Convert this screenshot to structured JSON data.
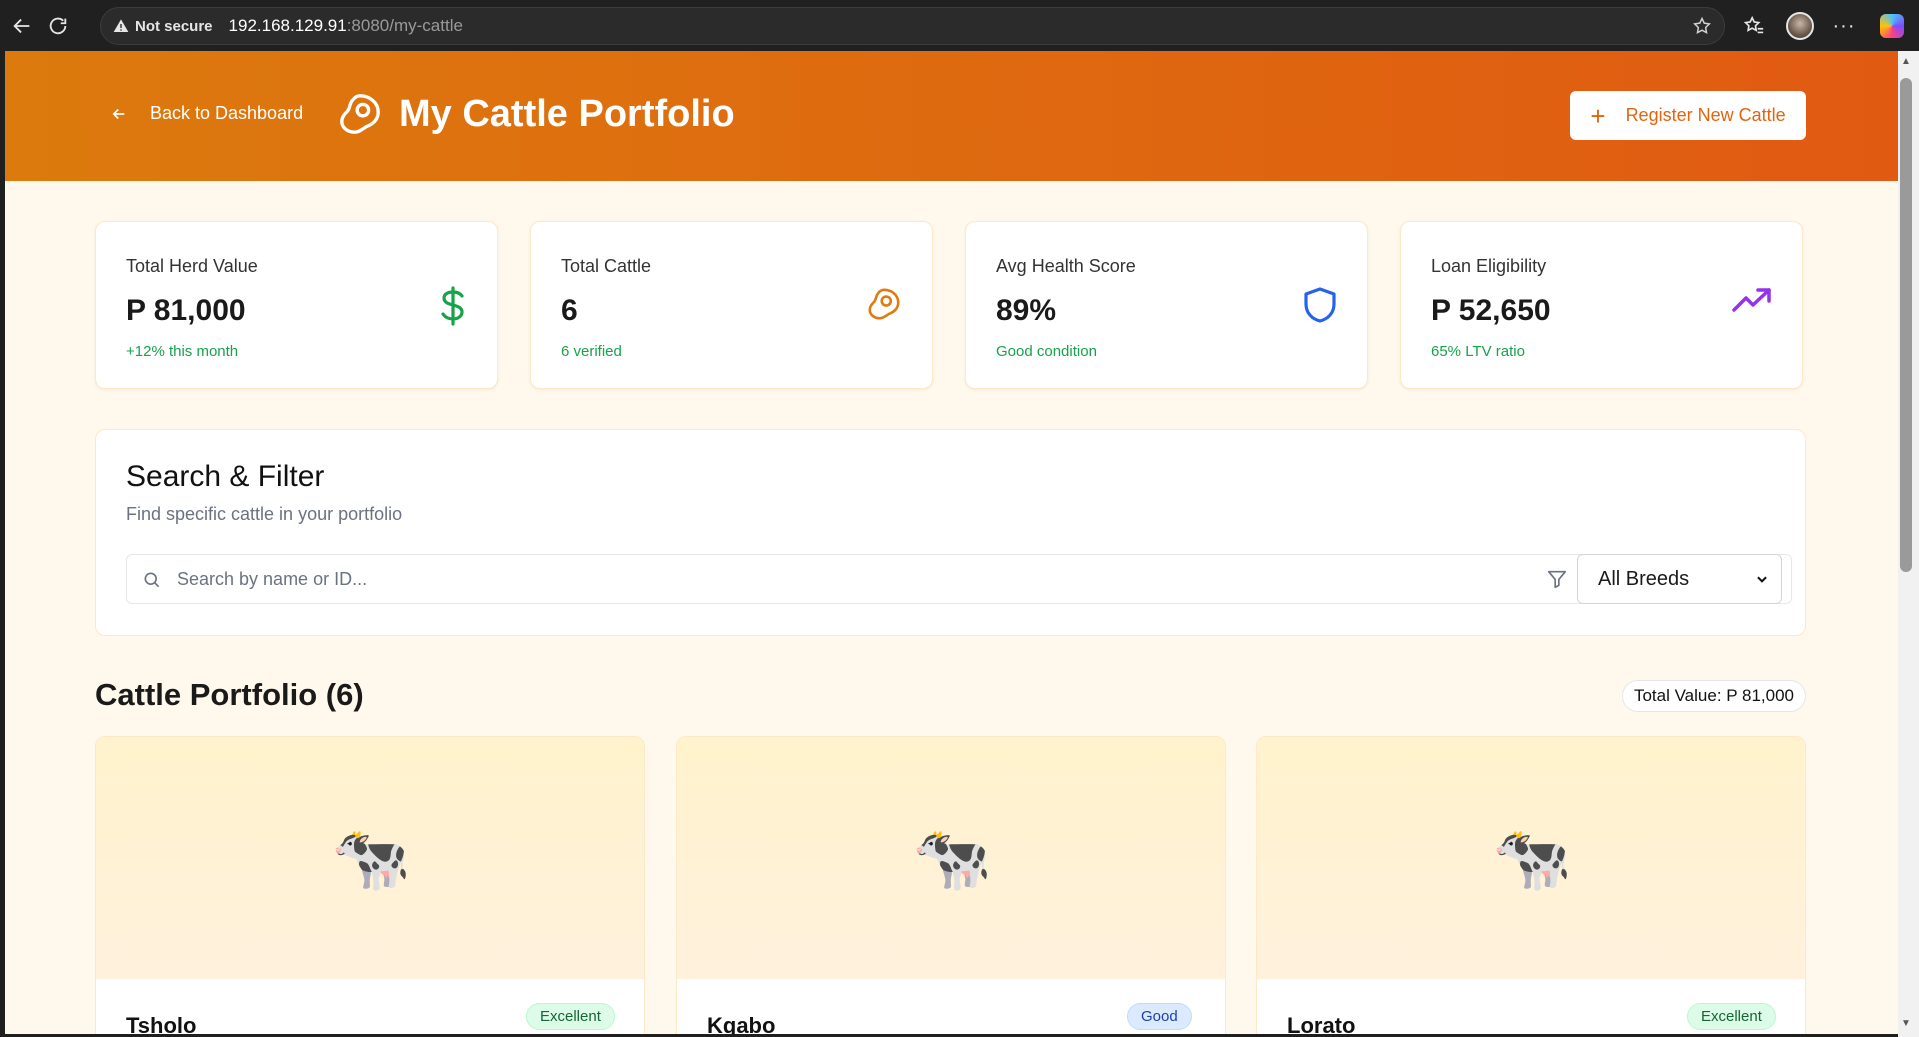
{
  "browser": {
    "security_label": "Not secure",
    "url_host": "192.168.129.91",
    "url_rest": ":8080/my-cattle"
  },
  "header": {
    "back_label": "Back to Dashboard",
    "title": "My Cattle Portfolio",
    "register_label": "Register New Cattle"
  },
  "stats": [
    {
      "label": "Total Herd Value",
      "value": "P 81,000",
      "sub": "+12% this month",
      "icon": "dollar-icon",
      "icon_color": "#16a34a"
    },
    {
      "label": "Total Cattle",
      "value": "6",
      "sub": "6 verified",
      "icon": "cattle-logo-icon",
      "icon_color": "#e07b12"
    },
    {
      "label": "Avg Health Score",
      "value": "89%",
      "sub": "Good condition",
      "icon": "shield-icon",
      "icon_color": "#2563eb"
    },
    {
      "label": "Loan Eligibility",
      "value": "P 52,650",
      "sub": "65% LTV ratio",
      "icon": "trending-up-icon",
      "icon_color": "#9333ea"
    }
  ],
  "search": {
    "title": "Search & Filter",
    "subtitle": "Find specific cattle in your portfolio",
    "placeholder": "Search by name or ID...",
    "breed_selected": "All Breeds"
  },
  "portfolio": {
    "title": "Cattle Portfolio (6)",
    "total_value": "Total Value: P 81,000",
    "cattle": [
      {
        "name": "Tsholo",
        "health": "Excellent",
        "emoji": "🐄"
      },
      {
        "name": "Kgabo",
        "health": "Good",
        "emoji": "🐄"
      },
      {
        "name": "Lorato",
        "health": "Excellent",
        "emoji": "🐄"
      }
    ]
  },
  "colors": {
    "header_start": "#dc7a0d",
    "header_end": "#e15a12",
    "accent": "#e2640f",
    "page_bg": "#fff8ec"
  }
}
